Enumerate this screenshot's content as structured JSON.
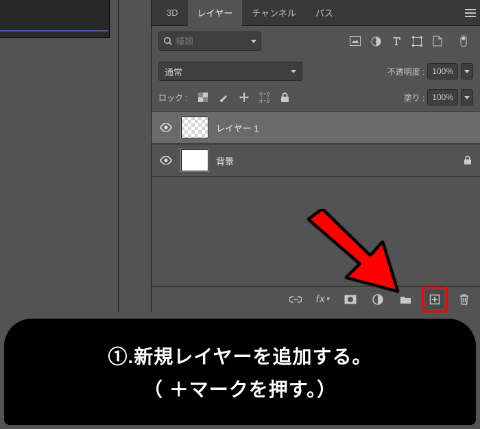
{
  "tabs": {
    "threeD": "3D",
    "layers": "レイヤー",
    "channels": "チャンネル",
    "paths": "パス"
  },
  "filter": {
    "placeholder": "種類"
  },
  "blend": {
    "mode": "通常",
    "opacityLabel": "不透明度 :",
    "opacityValue": "100%"
  },
  "lock": {
    "label": "ロック :",
    "fillLabel": "塗り :",
    "fillValue": "100%"
  },
  "layers": [
    {
      "name": "レイヤー 1"
    },
    {
      "name": "背景"
    }
  ],
  "caption": {
    "line1": "①.新規レイヤーを追加する。",
    "line2": "（ ＋マークを押す。）"
  },
  "footer": {
    "fx": "fx"
  }
}
